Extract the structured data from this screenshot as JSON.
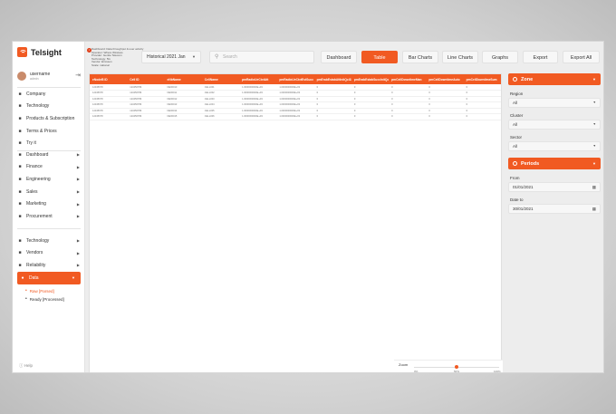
{
  "app": {
    "name": "Telsight"
  },
  "user": {
    "name": "username",
    "role": "admin"
  },
  "nav": {
    "main": [
      {
        "label": "Company",
        "icon": "building-icon"
      },
      {
        "label": "Technology",
        "icon": "technology-icon"
      },
      {
        "label": "Products & Subscription",
        "icon": "products-icon"
      },
      {
        "label": "Terms & Prices",
        "icon": "terms-icon"
      },
      {
        "label": "Try it",
        "icon": "try-icon"
      }
    ],
    "groups": [
      {
        "label": "Dashboard",
        "icon": "dashboard-icon"
      },
      {
        "label": "Finance",
        "icon": "finance-icon"
      },
      {
        "label": "Engineering",
        "icon": "engineering-icon"
      },
      {
        "label": "Sales",
        "icon": "sales-icon"
      },
      {
        "label": "Marketing",
        "icon": "marketing-icon"
      },
      {
        "label": "Procurement",
        "icon": "procurement-icon"
      }
    ],
    "lower": [
      {
        "label": "Technology",
        "icon": "technology-icon"
      },
      {
        "label": "Vendors",
        "icon": "vendors-icon"
      },
      {
        "label": "Reliability",
        "icon": "reliability-icon"
      }
    ],
    "data_item": {
      "label": "Data",
      "icon": "data-icon"
    },
    "data_sub": [
      {
        "label": "Raw [Parsed]",
        "selected": true
      },
      {
        "label": "Ready [Processed]",
        "selected": false
      }
    ],
    "help": "Help"
  },
  "info_lines": [
    "Dashboard: Data throughput & user activity",
    "Operator: Where Wireless",
    "Provider: Gentle Telecom",
    "Technology: 5G",
    "Vendor: Ericsson",
    "Scale: national"
  ],
  "period_select": {
    "value": "Historical 2021 Jan"
  },
  "search": {
    "placeholder": "Search"
  },
  "toolbar": {
    "dashboard": "Dashboard",
    "table": "Table",
    "bar_charts": "Bar Charts",
    "line_charts": "Line Charts",
    "graphs": "Graphs",
    "export": "Export",
    "export_all": "Export All"
  },
  "table": {
    "columns": [
      "eNodeB ID",
      "Cell ID",
      "eNbName",
      "CellName",
      "pmRadioUeCtxtAtt",
      "pmRadioUeCtxtEstSucc",
      "pmErabEstabAttInitQci1Hs1Hs5Hs9",
      "pmErabEstabSuccInitQci1Hs1Hs5Hs9",
      "pmCellDowntimeMan",
      "pmCellDowntimeAuto",
      "pmCellDowntimeSum"
    ],
    "rows": [
      [
        "12345678",
        "123456789",
        "NE00010",
        "CELL001",
        "1.0000000000E+03",
        "1.0000000000E+03",
        "0",
        "0",
        "0",
        "0",
        "0"
      ],
      [
        "12345678",
        "123456789",
        "NE00011",
        "CELL002",
        "1.0000000000E+03",
        "1.0000000000E+03",
        "0",
        "0",
        "0",
        "0",
        "0"
      ],
      [
        "12345678",
        "123456789",
        "NE00012",
        "CELL003",
        "1.0000000000E+03",
        "1.0000000000E+03",
        "0",
        "0",
        "0",
        "0",
        "0"
      ],
      [
        "12345678",
        "123456789",
        "NE00013",
        "CELL004",
        "1.0000000000E+03",
        "1.0000000000E+03",
        "0",
        "0",
        "0",
        "0",
        "0"
      ],
      [
        "12345678",
        "123456789",
        "NE00014",
        "CELL005",
        "1.0000000000E+03",
        "1.0000000000E+03",
        "0",
        "0",
        "0",
        "0",
        "0"
      ],
      [
        "12345678",
        "123456789",
        "NE00015",
        "CELL006",
        "1.0000000000E+03",
        "1.0000000000E+03",
        "0",
        "0",
        "0",
        "0",
        "0"
      ]
    ]
  },
  "zoom": {
    "label": "Zoom",
    "ticks": [
      "0%",
      "50%",
      "100%"
    ],
    "value_pct": 50
  },
  "filters": {
    "zone": {
      "title": "Zone",
      "region": {
        "label": "Region",
        "value": "All"
      },
      "cluster": {
        "label": "Cluster",
        "value": "All"
      },
      "sector": {
        "label": "Sector",
        "value": "All"
      }
    },
    "periods": {
      "title": "Periods",
      "from": {
        "label": "From",
        "value": "01/01/2021"
      },
      "to": {
        "label": "Date to",
        "value": "30/01/2021"
      }
    }
  },
  "colors": {
    "accent": "#f15a22"
  }
}
